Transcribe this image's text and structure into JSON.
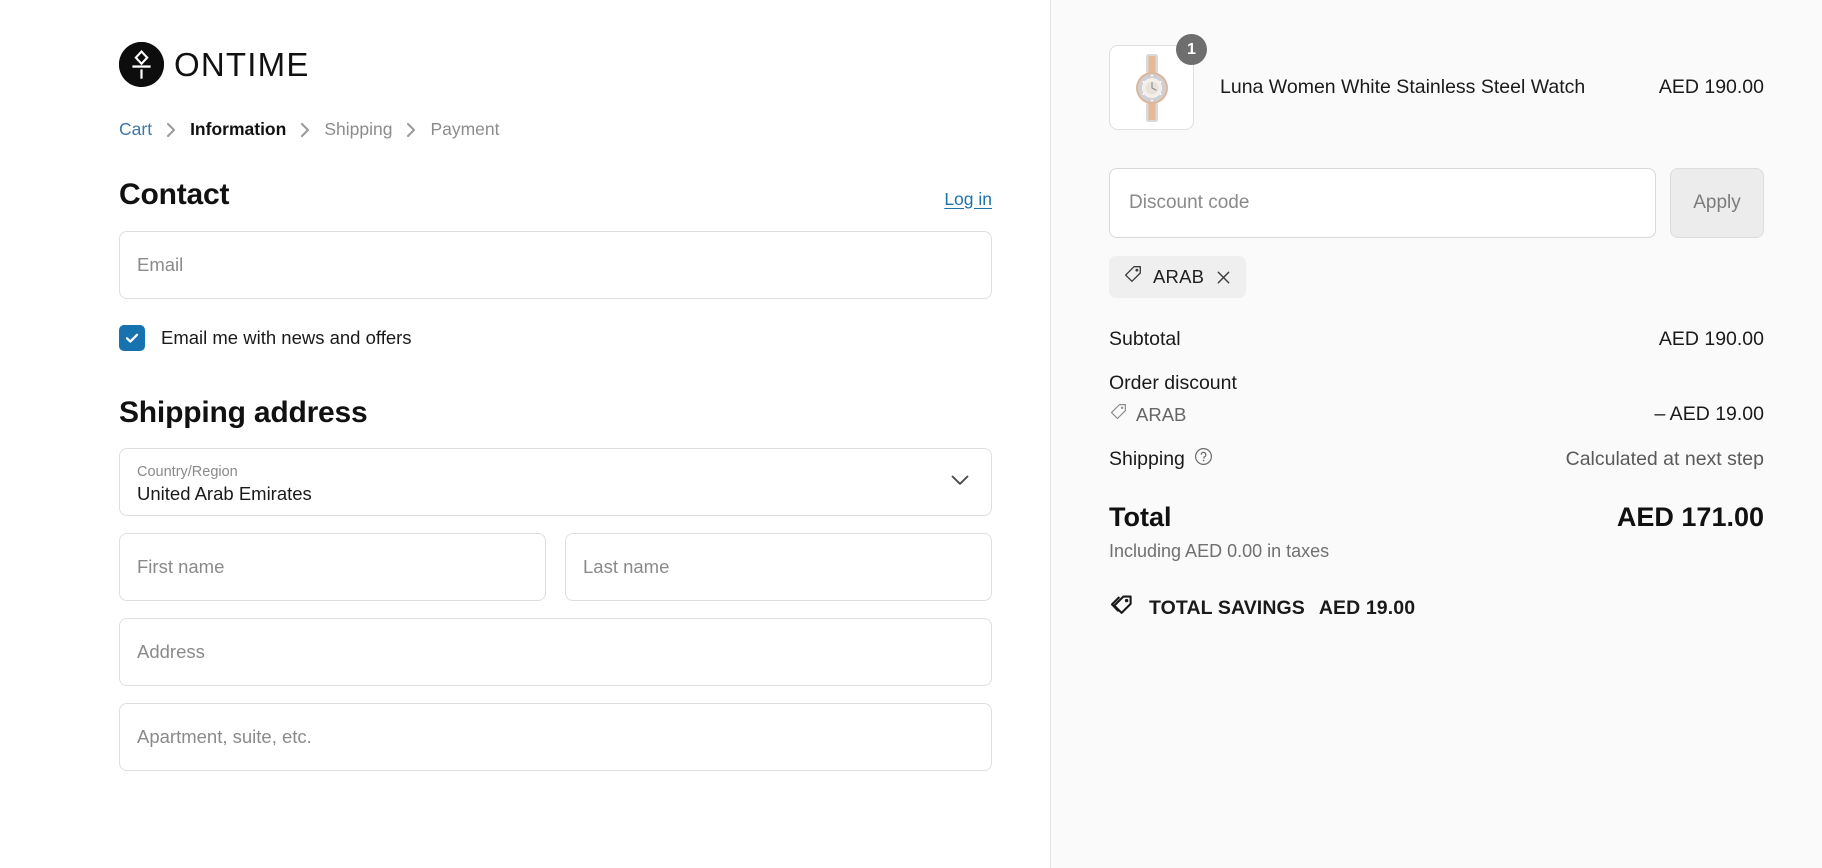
{
  "brand": {
    "name": "ONTIME",
    "logo_icon": "ontime-circle-logo"
  },
  "breadcrumb": {
    "separator": "›",
    "items": [
      {
        "label": "Cart",
        "state": "link"
      },
      {
        "label": "Information",
        "state": "active"
      },
      {
        "label": "Shipping",
        "state": "upcoming"
      },
      {
        "label": "Payment",
        "state": "upcoming"
      }
    ]
  },
  "contact": {
    "title": "Contact",
    "login_label": "Log in",
    "email_placeholder": "Email",
    "email_value": "",
    "newsletter_label": "Email me with news and offers",
    "newsletter_checked": true
  },
  "shipping_address": {
    "title": "Shipping address",
    "country": {
      "label": "Country/Region",
      "value": "United Arab Emirates"
    },
    "first_name_placeholder": "First name",
    "first_name_value": "",
    "last_name_placeholder": "Last name",
    "last_name_value": "",
    "address_placeholder": "Address",
    "address_value": "",
    "apartment_placeholder": "Apartment, suite, etc.",
    "apartment_value": ""
  },
  "summary": {
    "line_items": [
      {
        "name": "Luna Women White Stainless Steel Watch",
        "price": "AED 190.00",
        "quantity": "1"
      }
    ],
    "discount_input_placeholder": "Discount code",
    "discount_input_value": "",
    "apply_label": "Apply",
    "applied_discount_chip": "ARAB",
    "subtotal_label": "Subtotal",
    "subtotal_value": "AED 190.00",
    "order_discount_label": "Order discount",
    "order_discount_code": "ARAB",
    "order_discount_value": "– AED 19.00",
    "shipping_label": "Shipping",
    "shipping_value": "Calculated at next step",
    "total_label": "Total",
    "total_value": "AED 171.00",
    "tax_note": "Including AED 0.00 in taxes",
    "savings_label": "TOTAL SAVINGS",
    "savings_value": "AED 19.00"
  },
  "colors": {
    "link": "#1f72a8",
    "checkbox_accent": "#1773b0",
    "summary_bg": "#fafafa",
    "badge_bg": "#6e6e6e"
  }
}
